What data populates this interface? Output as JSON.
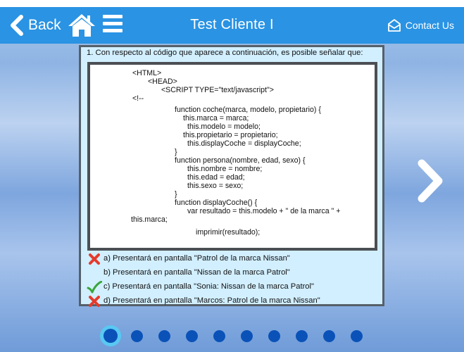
{
  "nav": {
    "back_label": "Back",
    "title": "Test Cliente I",
    "contact_label": "Contact Us",
    "icons": [
      "chevron-left-icon",
      "home-icon",
      "menu-icon",
      "mail-icon",
      "chevron-right-icon"
    ]
  },
  "question": {
    "text": "1. Con respecto al código que aparece a continuación, es posible señalar que:",
    "code": [
      "<HTML>",
      "<HEAD>",
      "<SCRIPT TYPE=\"text/javascript\">",
      "<!--",
      "function coche(marca, modelo, propietario) {",
      "this.marca = marca;",
      "this.modelo = modelo;",
      "this.propietario = propietario;",
      "this.displayCoche = displayCoche;",
      "}",
      "function persona(nombre, edad, sexo) {",
      "this.nombre = nombre;",
      "this.edad = edad;",
      "this.sexo = sexo;",
      "}",
      "function displayCoche() {",
      "var resultado = this.modelo + \" de la marca \" +",
      "this.marca;",
      "imprimir(resultado);"
    ]
  },
  "answers": [
    {
      "text": "a)  Presentará en pantalla \"Patrol de la marca Nissan\"",
      "status": "wrong"
    },
    {
      "text": "b)  Presentará en pantalla \"Nissan de la marca Patrol\"",
      "status": "none"
    },
    {
      "text": "c)  Presentará en pantalla \"Sonia: Nissan de la marca Patrol\"",
      "status": "correct"
    },
    {
      "text": "d)  Presentará en pantalla \"Marcos: Patrol de la marca Nissan\"",
      "status": "wrong"
    }
  ],
  "pagination": {
    "total": 10,
    "current": 1
  },
  "colors": {
    "navbar": "#2a93e3",
    "dot": "#0a52b8",
    "dot_ring": "#59c8f2",
    "wrong": "#e53b2c",
    "correct": "#3aa53a"
  }
}
